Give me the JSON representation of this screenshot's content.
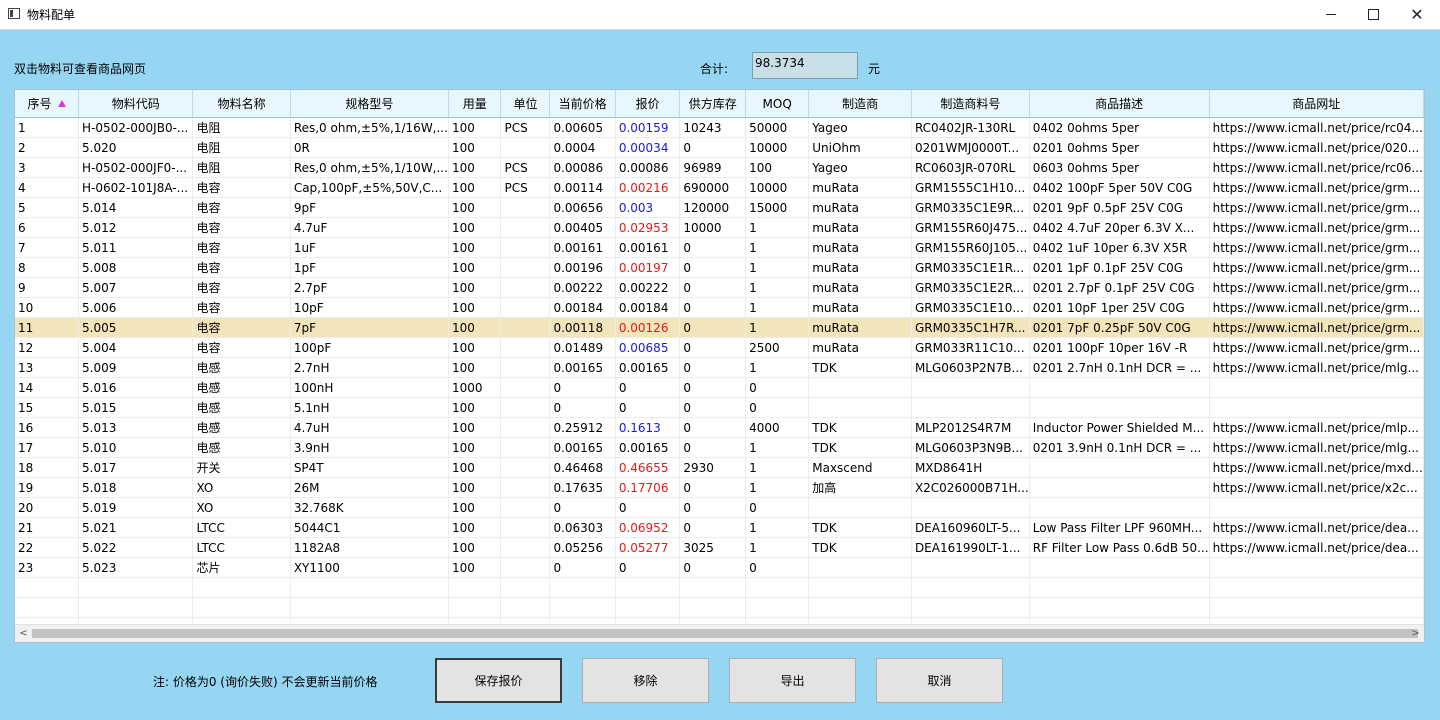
{
  "window": {
    "title": "物料配单",
    "minimize": "—",
    "maximize": "☐",
    "close": "✕"
  },
  "header": {
    "hint": "双击物料可查看商品网页",
    "total_label": "合计:",
    "total_value": "98.3734",
    "unit": "元"
  },
  "table": {
    "columns": [
      "序号",
      "物料代码",
      "物料名称",
      "规格型号",
      "用量",
      "单位",
      "当前价格",
      "报价",
      "供方库存",
      "MOQ",
      "制造商",
      "制造商料号",
      "商品描述",
      "商品网址"
    ],
    "sorted_column": "序号",
    "selected_row_index": 10,
    "rows": [
      {
        "cells": [
          "1",
          "H-0502-000JB0-...",
          "电阻",
          "Res,0 ohm,±5%,1/16W,...",
          "100",
          "PCS",
          "0.00605",
          "0.00159",
          "10243",
          "50000",
          "Yageo",
          "RC0402JR-130RL",
          "0402 0ohms   5per",
          "https://www.icmall.net/price/rc04..."
        ],
        "quote_color": "blue"
      },
      {
        "cells": [
          "2",
          "5.020",
          "电阻",
          "0R",
          "100",
          "",
          "0.0004",
          "0.00034",
          "0",
          "10000",
          "UniOhm",
          "0201WMJ0000T...",
          "0201 0ohms   5per",
          "https://www.icmall.net/price/020..."
        ],
        "quote_color": "blue"
      },
      {
        "cells": [
          "3",
          "H-0502-000JF0-...",
          "电阻",
          "Res,0 ohm,±5%,1/10W,...",
          "100",
          "PCS",
          "0.00086",
          "0.00086",
          "96989",
          "100",
          "Yageo",
          "RC0603JR-070RL",
          "0603 0ohms   5per",
          "https://www.icmall.net/price/rc06..."
        ],
        "quote_color": "black"
      },
      {
        "cells": [
          "4",
          "H-0602-101J8A-...",
          "电容",
          "Cap,100pF,±5%,50V,C...",
          "100",
          "PCS",
          "0.00114",
          "0.00216",
          "690000",
          "10000",
          "muRata",
          "GRM1555C1H10...",
          "0402 100pF  5per  50V C0G",
          "https://www.icmall.net/price/grm..."
        ],
        "quote_color": "red"
      },
      {
        "cells": [
          "5",
          "5.014",
          "电容",
          "9pF",
          "100",
          "",
          "0.00656",
          "0.003",
          "120000",
          "15000",
          "muRata",
          "GRM0335C1E9R...",
          "0201 9pF  0.5pF 25V C0G",
          "https://www.icmall.net/price/grm..."
        ],
        "quote_color": "blue"
      },
      {
        "cells": [
          "6",
          "5.012",
          "电容",
          "4.7uF",
          "100",
          "",
          "0.00405",
          "0.02953",
          "10000",
          "1",
          "muRata",
          "GRM155R60J475...",
          "0402 4.7uF  20per  6.3V X...",
          "https://www.icmall.net/price/grm..."
        ],
        "quote_color": "red"
      },
      {
        "cells": [
          "7",
          "5.011",
          "电容",
          "1uF",
          "100",
          "",
          "0.00161",
          "0.00161",
          "0",
          "1",
          "muRata",
          "GRM155R60J105...",
          "0402 1uF  10per  6.3V X5R",
          "https://www.icmall.net/price/grm..."
        ],
        "quote_color": "black"
      },
      {
        "cells": [
          "8",
          "5.008",
          "电容",
          "1pF",
          "100",
          "",
          "0.00196",
          "0.00197",
          "0",
          "1",
          "muRata",
          "GRM0335C1E1R...",
          "0201 1pF  0.1pF 25V C0G",
          "https://www.icmall.net/price/grm..."
        ],
        "quote_color": "red"
      },
      {
        "cells": [
          "9",
          "5.007",
          "电容",
          "2.7pF",
          "100",
          "",
          "0.00222",
          "0.00222",
          "0",
          "1",
          "muRata",
          "GRM0335C1E2R...",
          "0201 2.7pF  0.1pF 25V C0G",
          "https://www.icmall.net/price/grm..."
        ],
        "quote_color": "black"
      },
      {
        "cells": [
          "10",
          "5.006",
          "电容",
          "10pF",
          "100",
          "",
          "0.00184",
          "0.00184",
          "0",
          "1",
          "muRata",
          "GRM0335C1E10...",
          "0201 10pF  1per  25V C0G",
          "https://www.icmall.net/price/grm..."
        ],
        "quote_color": "black"
      },
      {
        "cells": [
          "11",
          "5.005",
          "电容",
          "7pF",
          "100",
          "",
          "0.00118",
          "0.00126",
          "0",
          "1",
          "muRata",
          "GRM0335C1H7R...",
          "0201 7pF  0.25pF 50V C0G",
          "https://www.icmall.net/price/grm..."
        ],
        "quote_color": "red"
      },
      {
        "cells": [
          "12",
          "5.004",
          "电容",
          "100pF",
          "100",
          "",
          "0.01489",
          "0.00685",
          "0",
          "2500",
          "muRata",
          "GRM033R11C10...",
          "0201 100pF  10per  16V -R",
          "https://www.icmall.net/price/grm..."
        ],
        "quote_color": "blue"
      },
      {
        "cells": [
          "13",
          "5.009",
          "电感",
          "2.7nH",
          "100",
          "",
          "0.00165",
          "0.00165",
          "0",
          "1",
          "TDK",
          "MLG0603P2N7B...",
          "0201 2.7nH  0.1nH DCR = ...",
          "https://www.icmall.net/price/mlg..."
        ],
        "quote_color": "black"
      },
      {
        "cells": [
          "14",
          "5.016",
          "电感",
          "100nH",
          "1000",
          "",
          "0",
          "0",
          "0",
          "0",
          "",
          "",
          "",
          ""
        ],
        "quote_color": "black"
      },
      {
        "cells": [
          "15",
          "5.015",
          "电感",
          "5.1nH",
          "100",
          "",
          "0",
          "0",
          "0",
          "0",
          "",
          "",
          "",
          ""
        ],
        "quote_color": "black"
      },
      {
        "cells": [
          "16",
          "5.013",
          "电感",
          "4.7uH",
          "100",
          "",
          "0.25912",
          "0.1613",
          "0",
          "4000",
          "TDK",
          "MLP2012S4R7M",
          "Inductor Power Shielded M...",
          "https://www.icmall.net/price/mlp..."
        ],
        "quote_color": "blue"
      },
      {
        "cells": [
          "17",
          "5.010",
          "电感",
          "3.9nH",
          "100",
          "",
          "0.00165",
          "0.00165",
          "0",
          "1",
          "TDK",
          "MLG0603P3N9B...",
          "0201 3.9nH  0.1nH DCR = ...",
          "https://www.icmall.net/price/mlg..."
        ],
        "quote_color": "black"
      },
      {
        "cells": [
          "18",
          "5.017",
          "开关",
          "SP4T",
          "100",
          "",
          "0.46468",
          "0.46655",
          "2930",
          "1",
          "Maxscend",
          "MXD8641H",
          "",
          "https://www.icmall.net/price/mxd..."
        ],
        "quote_color": "red"
      },
      {
        "cells": [
          "19",
          "5.018",
          "XO",
          "26M",
          "100",
          "",
          "0.17635",
          "0.17706",
          "0",
          "1",
          "加高",
          "X2C026000B71H...",
          "",
          "https://www.icmall.net/price/x2c..."
        ],
        "quote_color": "red"
      },
      {
        "cells": [
          "20",
          "5.019",
          "XO",
          "32.768K",
          "100",
          "",
          "0",
          "0",
          "0",
          "0",
          "",
          "",
          "",
          ""
        ],
        "quote_color": "black"
      },
      {
        "cells": [
          "21",
          "5.021",
          "LTCC",
          "5044C1",
          "100",
          "",
          "0.06303",
          "0.06952",
          "0",
          "1",
          "TDK",
          "DEA160960LT-5...",
          "Low Pass Filter LPF 960MH...",
          "https://www.icmall.net/price/dea..."
        ],
        "quote_color": "red"
      },
      {
        "cells": [
          "22",
          "5.022",
          "LTCC",
          "1182A8",
          "100",
          "",
          "0.05256",
          "0.05277",
          "3025",
          "1",
          "TDK",
          "DEA161990LT-1...",
          "RF Filter Low Pass 0.6dB 50...",
          "https://www.icmall.net/price/dea..."
        ],
        "quote_color": "red"
      },
      {
        "cells": [
          "23",
          "5.023",
          "芯片",
          "XY1100",
          "100",
          "",
          "0",
          "0",
          "0",
          "0",
          "",
          "",
          "",
          ""
        ],
        "quote_color": "black"
      }
    ],
    "empty_row_count": 3,
    "scroll_left_icon": "chevron-left-icon",
    "scroll_right_icon": "chevron-right-icon"
  },
  "footer": {
    "note": "注: 价格为0 (询价失败) 不会更新当前价格",
    "buttons": {
      "save": "保存报价",
      "remove": "移除",
      "export": "导出",
      "cancel": "取消"
    }
  },
  "colors": {
    "background": "#97d6f2",
    "selected_row": "#f2e4bb",
    "quote_higher": "#e21b1b",
    "quote_lower": "#1a1adb",
    "sort_arrow": "#d63ad9"
  }
}
